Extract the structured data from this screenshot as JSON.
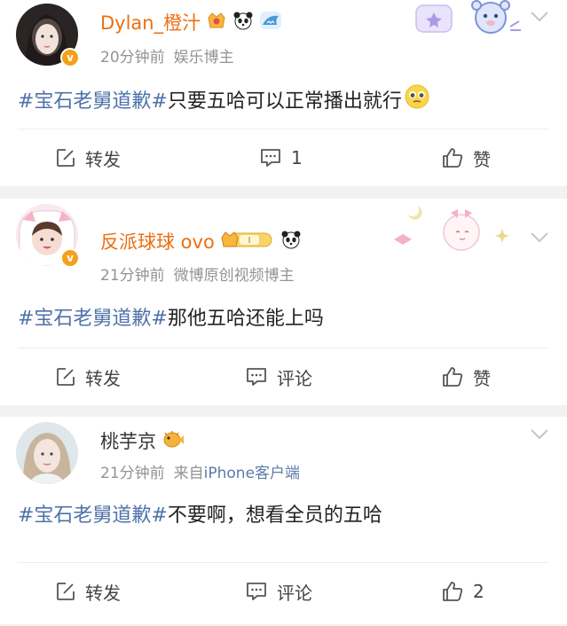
{
  "posts": [
    {
      "user": "Dylan_橙汁",
      "time": "20分钟前",
      "source": "娱乐博主",
      "topic": "#宝石老舅道歉#",
      "content": "只要五哈可以正常播出就行",
      "share_label": "转发",
      "comment_label": "1",
      "like_label": "赞",
      "verified": true
    },
    {
      "user": "反派球球 ovo",
      "time": "21分钟前",
      "source": "微博原创视频博主",
      "topic": "#宝石老舅道歉#",
      "content": "那他五哈还能上吗",
      "share_label": "转发",
      "comment_label": "评论",
      "like_label": "赞",
      "verified": true,
      "level_badge": "I"
    },
    {
      "user": "桃芋京",
      "time": "21分钟前",
      "source_prefix": "来自",
      "source": "iPhone客户端",
      "topic": "#宝石老舅道歉#",
      "content": "不要啊，想看全员的五哈",
      "share_label": "转发",
      "comment_label": "评论",
      "like_label": "2",
      "verified": false
    }
  ],
  "icons": {
    "share": "edit-share-icon",
    "comment": "comment-bubble-icon",
    "like": "thumbs-up-icon",
    "more": "chevron-down-icon"
  },
  "colors": {
    "vip_name": "#eb6f12",
    "topic": "#4e71a8",
    "meta": "#939393",
    "verified": "#f4a11a"
  }
}
